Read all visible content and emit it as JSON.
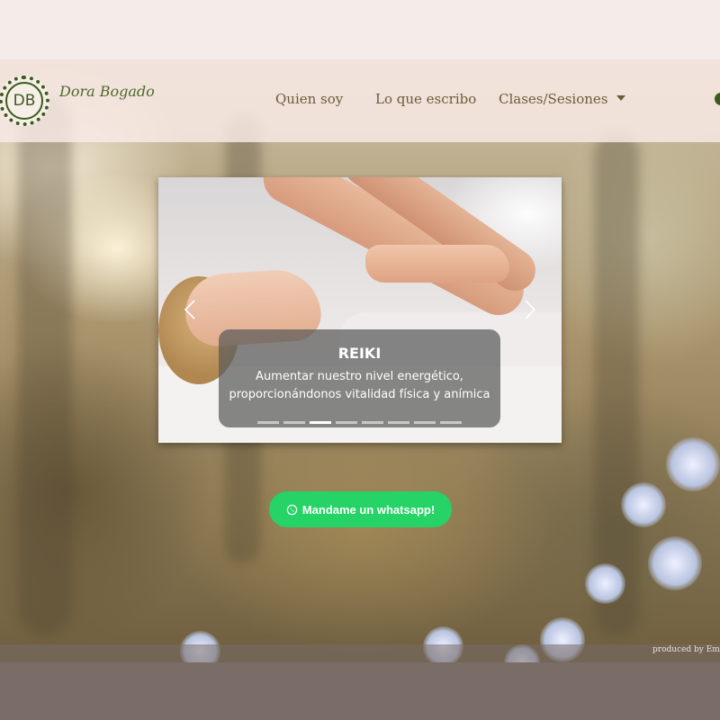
{
  "brand": {
    "logo_initials": "DB",
    "name": "Dora Bogado"
  },
  "nav": {
    "items": [
      {
        "label": "Quien soy"
      },
      {
        "label": "Lo que escribo"
      },
      {
        "label": "Clases/Sesiones",
        "dropdown": true
      }
    ]
  },
  "carousel": {
    "slide": {
      "title": "REIKI",
      "text": "Aumentar nuestro nivel energético, proporcionándonos vitalidad física y anímica"
    },
    "indicator_count": 8,
    "active_index": 2,
    "prev_icon": "chevron-left-icon",
    "next_icon": "chevron-right-icon"
  },
  "whatsapp_button": {
    "label": "Mandame un whatsapp!",
    "icon": "whatsapp-icon",
    "color": "#25d366"
  },
  "footer": {
    "produced": "produced by Emm"
  },
  "colors": {
    "accent_green": "#3d5a1f",
    "nav_text": "#6c5a35",
    "top_band": "#f5ebe8",
    "bottom_band": "#7a6c67"
  }
}
